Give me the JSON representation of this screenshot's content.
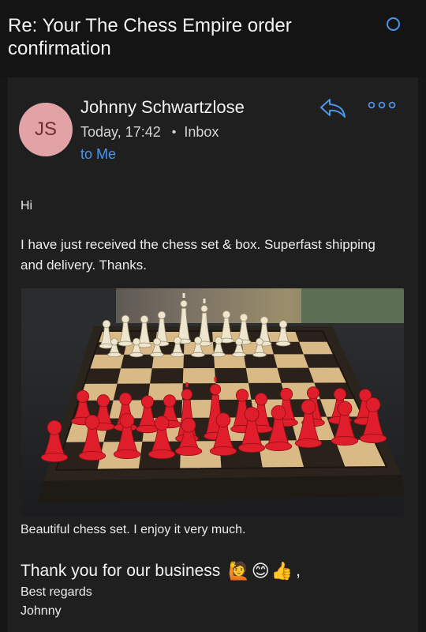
{
  "email": {
    "subject": "Re: Your The Chess Empire order confirmation",
    "sender": {
      "initials": "JS",
      "name": "Johnny Schwartzlose",
      "date": "Today, 17:42",
      "folder": "Inbox",
      "recipient": "to Me"
    },
    "greeting": "Hi",
    "body": "I have just received the chess set & box. Superfast shipping and delivery. Thanks.",
    "caption": "Beautiful chess set. I enjoy it very much.",
    "thanks_line": "Thank you for our business",
    "thanks_suffix": ",",
    "regards": "Best regards",
    "signature": "Johnny"
  },
  "icons": {
    "radio": "radio-circle-icon",
    "reply": "reply-icon",
    "more": "more-options-icon"
  },
  "emojis": [
    "🙋",
    "😊",
    "👍"
  ],
  "colors": {
    "accent": "#4a95e8",
    "avatar_bg": "#e2a3a6",
    "background": "#161616",
    "card": "#1f1f1f",
    "red_pieces": "#e01d2a",
    "light_pieces": "#efe6cf"
  }
}
